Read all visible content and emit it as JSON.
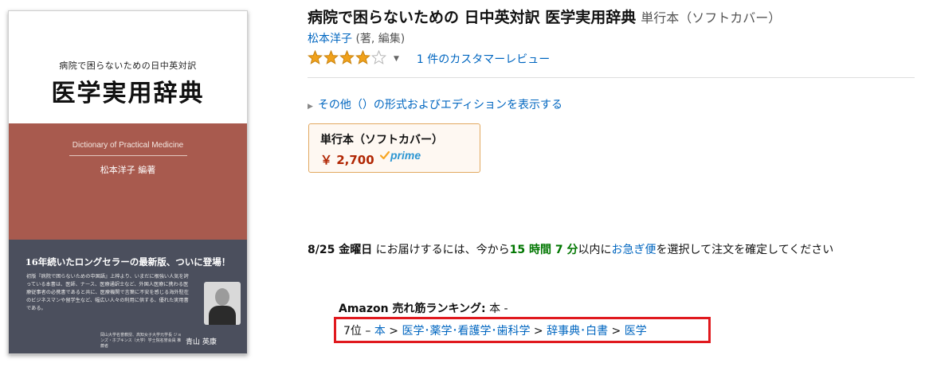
{
  "cover": {
    "subtitle": "病院で困らないための日中英対訳",
    "title": "医学実用辞典",
    "english_title": "Dictionary of Practical Medicine",
    "author": "松本洋子 編著",
    "catchphrase": "16年続いたロングセラーの最新版、ついに登場！",
    "blurb": "初版『病院で困らないための中国語』上梓より、いまだに根強い人気を誇っている本書は、医師、ナース、医療通訳士など、外国人医療に携わる医療従事者の必携書であると共に、医療機関で言葉に不安を感じる海外駐在のビジネスマンや留学生など、幅広い人々の利用に供する、優れた実用書である。",
    "recommender_affiliation": "岡山大学名誉教授、高知女子大学元学長 ジョンズ・ホプキンス（大学）学士院名誉会員 推薦者",
    "recommender_name": "青山 英康"
  },
  "product": {
    "title": "病院で困らないための 日中英対訳 医学実用辞典",
    "format_suffix": "単行本（ソフトカバー）",
    "author_name": "松本洋子",
    "author_role": " (著, 編集)",
    "rating": 4,
    "rating_max": 5,
    "review_link": "1 件のカスタマーレビュー",
    "other_formats": "その他（）の形式およびエディションを表示する"
  },
  "format_box": {
    "name": "単行本（ソフトカバー）",
    "price": "￥ 2,700",
    "prime_label": "prime"
  },
  "delivery": {
    "date": "8/25 金曜日",
    "text1": " にお届けするには、今から",
    "time": "15 時間 7 分",
    "text2": "以内に",
    "link": "お急ぎ便",
    "text3": "を選択して注文を確定してください"
  },
  "ranking": {
    "label": "Amazon 売れ筋ランキング:",
    "head_suffix": " 本 -",
    "rank": "7位 – ",
    "path": [
      "本",
      "医学･薬学･看護学･歯科学",
      "辞事典･白書",
      "医学"
    ],
    "separator": " > "
  },
  "colors": {
    "link": "#0066c0",
    "price": "#b12704",
    "green": "#007600",
    "star": "#f0a11b",
    "highlight_box": "#e0191e",
    "cover_red": "#a85a4e",
    "cover_dark": "#4b4f5d"
  }
}
